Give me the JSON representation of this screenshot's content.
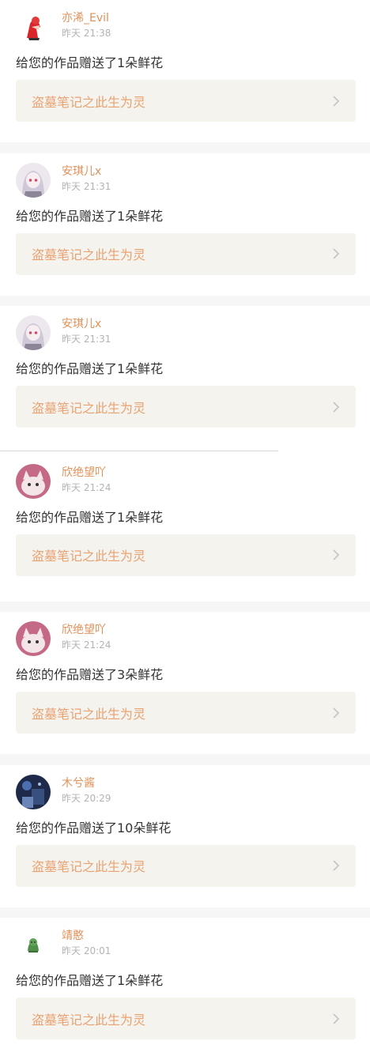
{
  "colors": {
    "accent": "#e0915a",
    "link": "#e9a272",
    "card_bg": "#f4f3ee",
    "time": "#b3b3b3"
  },
  "items": [
    {
      "name": "亦浠_Evil",
      "time": "昨天 21:38",
      "message": "给您的作品赠送了1朵鲜花",
      "work": "盗墓笔记之此生为灵",
      "avatar_icon": "red-cartoon-avatar"
    },
    {
      "name": "安琪儿x",
      "time": "昨天 21:31",
      "message": "给您的作品赠送了1朵鲜花",
      "work": "盗墓笔记之此生为灵",
      "avatar_icon": "anime-girl-avatar"
    },
    {
      "name": "安琪儿x",
      "time": "昨天 21:31",
      "message": "给您的作品赠送了1朵鲜花",
      "work": "盗墓笔记之此生为灵",
      "avatar_icon": "anime-girl-avatar"
    },
    {
      "name": "欣绝望吖",
      "time": "昨天 21:24",
      "message": "给您的作品赠送了1朵鲜花",
      "work": "盗墓笔记之此生为灵",
      "avatar_icon": "cat-avatar"
    },
    {
      "name": "欣绝望吖",
      "time": "昨天 21:24",
      "message": "给您的作品赠送了3朵鲜花",
      "work": "盗墓笔记之此生为灵",
      "avatar_icon": "cat-avatar"
    },
    {
      "name": "木兮酱",
      "time": "昨天 20:29",
      "message": "给您的作品赠送了10朵鲜花",
      "work": "盗墓笔记之此生为灵",
      "avatar_icon": "night-photo-avatar"
    },
    {
      "name": "靖憨",
      "time": "昨天 20:01",
      "message": "给您的作品赠送了1朵鲜花",
      "work": "盗墓笔记之此生为灵",
      "avatar_icon": "green-figure-avatar"
    }
  ]
}
